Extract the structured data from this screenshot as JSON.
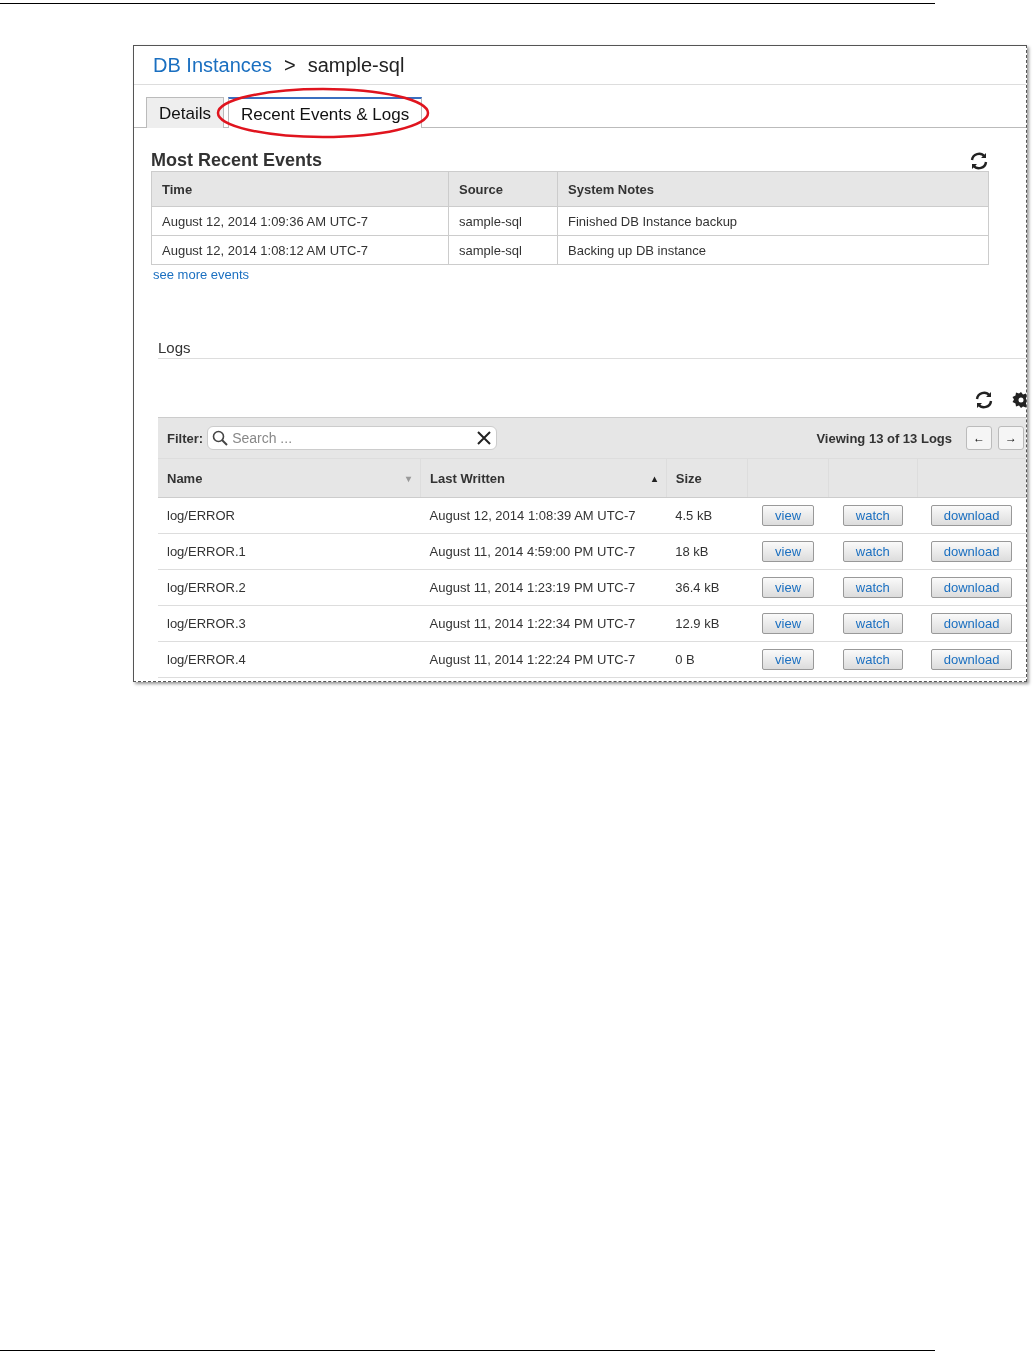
{
  "breadcrumb": {
    "link": "DB Instances",
    "separator": ">",
    "current": "sample-sql"
  },
  "tabs": [
    {
      "label": "Details",
      "selected": false,
      "highlighted": false
    },
    {
      "label": "Recent Events & Logs",
      "selected": true,
      "highlighted": true
    }
  ],
  "events": {
    "title": "Most Recent Events",
    "columns": [
      "Time",
      "Source",
      "System Notes"
    ],
    "rows": [
      [
        "August 12, 2014 1:09:36 AM UTC-7",
        "sample-sql",
        "Finished DB Instance backup"
      ],
      [
        "August 12, 2014 1:08:12 AM UTC-7",
        "sample-sql",
        "Backing up DB instance"
      ]
    ],
    "more_link": "see more events"
  },
  "logs": {
    "title": "Logs",
    "filter_label": "Filter:",
    "search_placeholder": "Search ...",
    "viewing": "Viewing 13 of 13 Logs",
    "prev": "←",
    "next": "→",
    "columns": [
      {
        "label": "Name",
        "sort_icon": "▾",
        "sort_active": false
      },
      {
        "label": "Last Written",
        "sort_icon": "▴",
        "sort_active": true
      },
      {
        "label": "Size"
      }
    ],
    "rows": [
      {
        "name": "log/ERROR",
        "written": "August 12, 2014 1:08:39 AM UTC-7",
        "size": "4.5 kB",
        "actions": [
          "view",
          "watch",
          "download"
        ]
      },
      {
        "name": "log/ERROR.1",
        "written": "August 11, 2014 4:59:00 PM UTC-7",
        "size": "18 kB",
        "actions": [
          "view",
          "watch",
          "download"
        ]
      },
      {
        "name": "log/ERROR.2",
        "written": "August 11, 2014 1:23:19 PM UTC-7",
        "size": "36.4 kB",
        "actions": [
          "view",
          "watch",
          "download"
        ]
      },
      {
        "name": "log/ERROR.3",
        "written": "August 11, 2014 1:22:34 PM UTC-7",
        "size": "12.9 kB",
        "actions": [
          "view",
          "watch",
          "download"
        ]
      },
      {
        "name": "log/ERROR.4",
        "written": "August 11, 2014 1:22:24 PM UTC-7",
        "size": "0 B",
        "actions": [
          "view",
          "watch",
          "download"
        ]
      }
    ]
  }
}
